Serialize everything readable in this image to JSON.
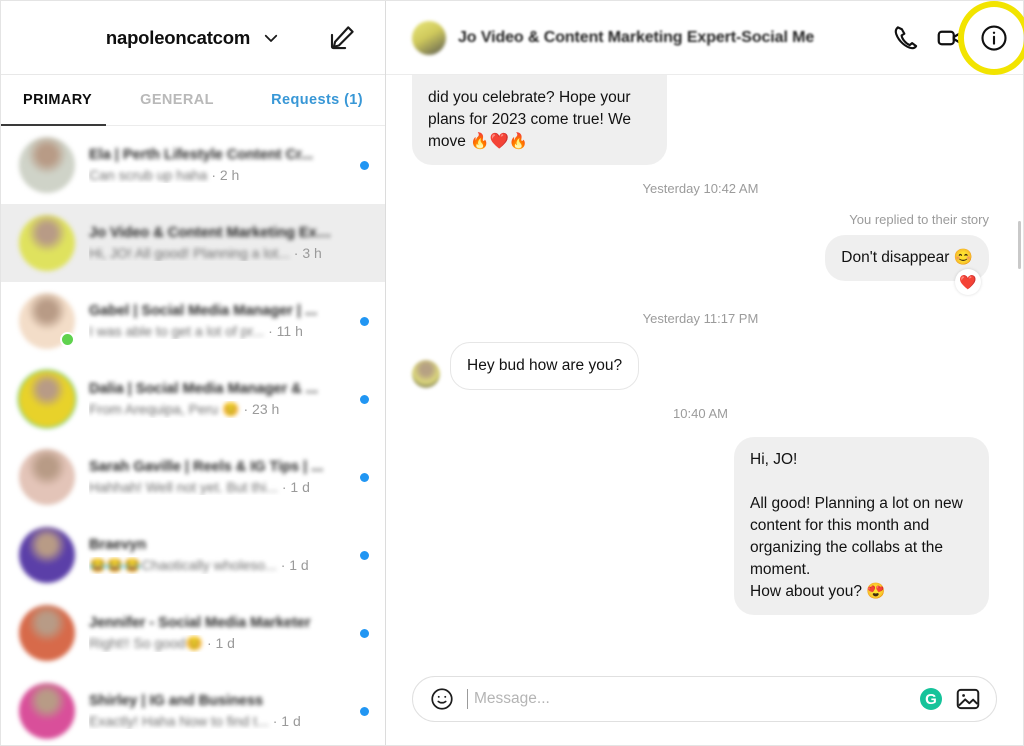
{
  "sidebar": {
    "account": {
      "name": "napoleoncatcom",
      "chevron_icon": "chevron-down-icon"
    },
    "compose_icon": "compose-icon",
    "tabs": [
      {
        "label": "PRIMARY",
        "active": true
      },
      {
        "label": "GENERAL",
        "active": false
      },
      {
        "label": "Requests (1)",
        "active": false
      }
    ],
    "conversations": [
      {
        "title": "Ela | Perth Lifestyle Content Cr...",
        "snippet": "Can scrub up haha",
        "time": "· 2 h",
        "unread": true,
        "selected": false,
        "online": false,
        "story_ring": false,
        "avatar_color": "#cfd3c8"
      },
      {
        "title": "Jo Video & Content Marketing Expe...",
        "snippet": "Hi, JO! All good! Planning a lot...",
        "time": "· 3 h",
        "unread": false,
        "selected": true,
        "online": false,
        "story_ring": false,
        "avatar_color": "#dfe25e"
      },
      {
        "title": "Gabel | Social Media Manager | ...",
        "snippet": "I was able to get a lot of pr...",
        "time": "· 11 h",
        "unread": true,
        "selected": false,
        "online": true,
        "story_ring": false,
        "avatar_color": "#f3ddc8"
      },
      {
        "title": "Dalia | Social Media Manager & ...",
        "snippet": "From Arequipa, Peru 😊",
        "time": "· 23 h",
        "unread": true,
        "selected": false,
        "online": false,
        "story_ring": true,
        "avatar_color": "#e8d22a"
      },
      {
        "title": "Sarah Gaville | Reels & IG Tips | ...",
        "snippet": "Hahhah! Well not yet. But thi...",
        "time": "· 1 d",
        "unread": true,
        "selected": false,
        "online": false,
        "story_ring": false,
        "avatar_color": "#e3c4b8"
      },
      {
        "title": "Braevyn",
        "snippet": "😂😂😂Chaotically wholeso...",
        "time": "· 1 d",
        "unread": true,
        "selected": false,
        "online": false,
        "story_ring": false,
        "avatar_color": "#5b3fa8"
      },
      {
        "title": "Jennifer - Social Media Marketer",
        "snippet": "Right!! So good😊",
        "time": "· 1 d",
        "unread": true,
        "selected": false,
        "online": false,
        "story_ring": false,
        "avatar_color": "#d76a4a"
      },
      {
        "title": "Shirley | IG and Business",
        "snippet": "Exactly! Haha Now to find t...",
        "time": "· 1 d",
        "unread": true,
        "selected": false,
        "online": false,
        "story_ring": false,
        "avatar_color": "#d94f9a"
      }
    ]
  },
  "chat": {
    "header": {
      "title": "Jo Video & Content Marketing Expert-Social Me",
      "avatar_icon": "contact-avatar",
      "call_icon": "phone-icon",
      "video_icon": "video-camera-icon",
      "info_icon": "info-icon",
      "info_highlight_color": "#f2e400"
    },
    "messages": [
      {
        "kind": "bubble",
        "side": "in",
        "clipped": true,
        "text": "did you celebrate? Hope your plans for 2023 come true! We move 🔥❤️🔥"
      },
      {
        "kind": "separator",
        "text": "Yesterday 10:42 AM"
      },
      {
        "kind": "meta",
        "text": "You replied to their story"
      },
      {
        "kind": "bubble",
        "side": "out",
        "text": "Don't disappear 😊",
        "reaction": "❤️"
      },
      {
        "kind": "separator",
        "text": "Yesterday 11:17 PM"
      },
      {
        "kind": "bubble",
        "side": "in",
        "avatar": true,
        "text": "Hey bud how are you?"
      },
      {
        "kind": "separator",
        "text": "10:40 AM"
      },
      {
        "kind": "bubble",
        "side": "out",
        "text": "Hi, JO!\n\nAll good! Planning a lot on new content for this month and organizing the collabs at the moment.\nHow about you? 😍"
      }
    ],
    "composer": {
      "emoji_icon": "emoji-smiley-icon",
      "placeholder": "Message...",
      "value": "",
      "grammarly_icon": "grammarly-icon",
      "grammarly_letter": "G",
      "grammarly_color": "#15c39a",
      "gallery_icon": "image-icon"
    }
  }
}
